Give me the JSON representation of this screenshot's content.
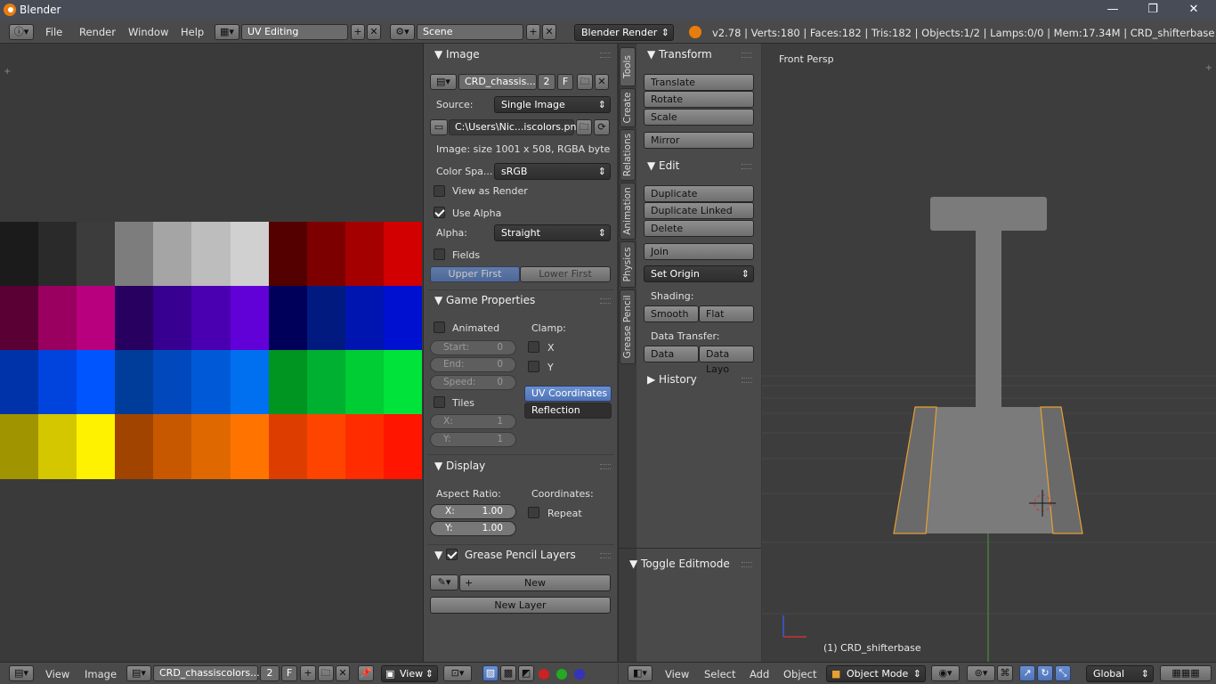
{
  "window": {
    "title": "Blender",
    "controls": [
      "—",
      "❐",
      "✕"
    ]
  },
  "topbar": {
    "menus": [
      "File",
      "Render",
      "Window",
      "Help"
    ],
    "screen_layout": "UV Editing",
    "scene": "Scene",
    "render_engine": "Blender Render",
    "info": "v2.78 | Verts:180 | Faces:182 | Tris:182 | Objects:1/2 | Lamps:0/0 | Mem:17.34M | CRD_shifterbase"
  },
  "image_editor": {
    "swatch_rows": [
      [
        "#1b1b1b",
        "#2a2a2a",
        "#3c3c3c",
        "#7d7d7d",
        "#a5a5a5",
        "#bdbdbd",
        "#d0d0d0",
        "#540000",
        "#7d0000",
        "#a50000",
        "#d20000"
      ],
      [
        "#5a0034",
        "#9a0060",
        "#b8007f",
        "#270060",
        "#380090",
        "#4a00b0",
        "#6200d8",
        "#00005a",
        "#001a80",
        "#0015b0",
        "#0010d0"
      ],
      [
        "#0033aa",
        "#0044dd",
        "#0055ff",
        "#003c99",
        "#0048bb",
        "#005ad8",
        "#0070f0",
        "#009420",
        "#00b030",
        "#00cc33",
        "#00e33a"
      ],
      [
        "#a09400",
        "#d4c700",
        "#fff200",
        "#a04400",
        "#c85800",
        "#e06800",
        "#ff7400",
        "#dd3e00",
        "#ff4400",
        "#ff2c00",
        "#ff1500"
      ]
    ]
  },
  "properties": {
    "image_section": "Image",
    "image_name": "CRD_chassis...",
    "users": "2",
    "fake_user": "F",
    "source_label": "Source:",
    "source_value": "Single Image",
    "filepath": "C:\\Users\\Nic...iscolors.png",
    "image_info": "Image: size 1001 x 508, RGBA byte",
    "colorspace_label": "Color Spa...",
    "colorspace_value": "sRGB",
    "view_as_render": "View as Render",
    "use_alpha": "Use Alpha",
    "alpha_label": "Alpha:",
    "alpha_value": "Straight",
    "fields": "Fields",
    "upper_first": "Upper First",
    "lower_first": "Lower First",
    "game_section": "Game Properties",
    "animated": "Animated",
    "clamp": "Clamp:",
    "clamp_x": "X",
    "clamp_y": "Y",
    "start_label": "Start:",
    "start_value": "0",
    "end_label": "End:",
    "end_value": "0",
    "speed_label": "Speed:",
    "speed_value": "0",
    "tiles": "Tiles",
    "tile_x_label": "X:",
    "tile_x_value": "1",
    "tile_y_label": "Y:",
    "tile_y_value": "1",
    "uv_coordinates": "UV Coordinates",
    "reflection": "Reflection",
    "display_section": "Display",
    "aspect_ratio": "Aspect Ratio:",
    "coordinates": "Coordinates:",
    "aspect_x_label": "X:",
    "aspect_x_value": "1.00",
    "aspect_y_label": "Y:",
    "aspect_y_value": "1.00",
    "repeat": "Repeat",
    "gp_section": "Grease Pencil Layers",
    "new": "New",
    "new_layer": "New Layer"
  },
  "tool_tabs": [
    "Tools",
    "Create",
    "Relations",
    "Animation",
    "Physics",
    "Grease Pencil"
  ],
  "tool_shelf": {
    "transform": "Transform",
    "translate": "Translate",
    "rotate": "Rotate",
    "scale": "Scale",
    "mirror": "Mirror",
    "edit": "Edit",
    "duplicate": "Duplicate",
    "duplicate_linked": "Duplicate Linked",
    "delete": "Delete",
    "join": "Join",
    "set_origin": "Set Origin",
    "shading": "Shading:",
    "smooth": "Smooth",
    "flat": "Flat",
    "data_transfer": "Data Transfer:",
    "data": "Data",
    "data_layout": "Data Layo",
    "history": "History",
    "toggle_editmode": "Toggle Editmode"
  },
  "viewport": {
    "view_name": "Front Persp",
    "object_label": "(1) CRD_shifterbase"
  },
  "bottom_left": {
    "menus": [
      "View",
      "Image"
    ],
    "image_name": "CRD_chassiscolors....",
    "users": "2",
    "fake_user": "F",
    "view_select": "View"
  },
  "bottom_right": {
    "menus": [
      "View",
      "Select",
      "Add",
      "Object"
    ],
    "mode": "Object Mode",
    "orientation": "Global"
  }
}
